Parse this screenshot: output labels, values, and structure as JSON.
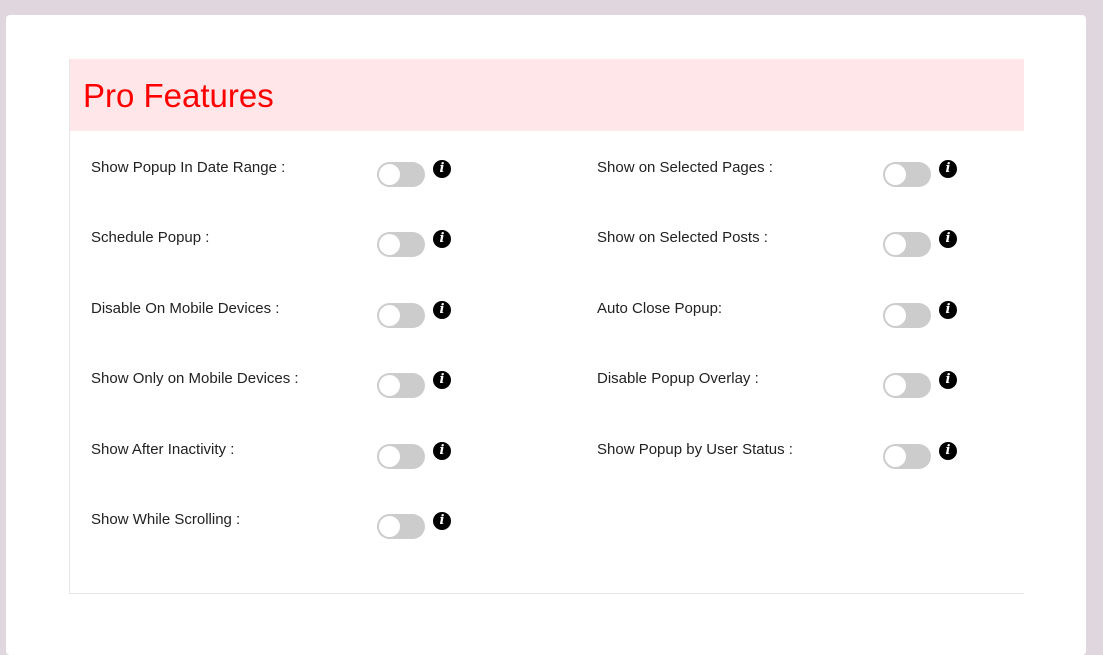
{
  "section": {
    "title": "Pro Features"
  },
  "left_column": [
    {
      "label": "Show Popup In Date Range :",
      "enabled": false
    },
    {
      "label": "Schedule Popup :",
      "enabled": false
    },
    {
      "label": "Disable On Mobile Devices :",
      "enabled": false
    },
    {
      "label": "Show Only on Mobile Devices :",
      "enabled": false
    },
    {
      "label": "Show After Inactivity :",
      "enabled": false
    },
    {
      "label": "Show While Scrolling :",
      "enabled": false
    }
  ],
  "right_column": [
    {
      "label": "Show on Selected Pages :",
      "enabled": false
    },
    {
      "label": "Show on Selected Posts :",
      "enabled": false
    },
    {
      "label": "Auto Close Popup:",
      "enabled": false
    },
    {
      "label": "Disable Popup Overlay :",
      "enabled": false
    },
    {
      "label": "Show Popup by User Status :",
      "enabled": false
    }
  ],
  "icons": {
    "info": "info-icon"
  },
  "colors": {
    "title": "#ff0000",
    "header_bg": "#ffe6e8",
    "toggle_off": "#cccccc",
    "page_bg": "#e0d7de"
  }
}
